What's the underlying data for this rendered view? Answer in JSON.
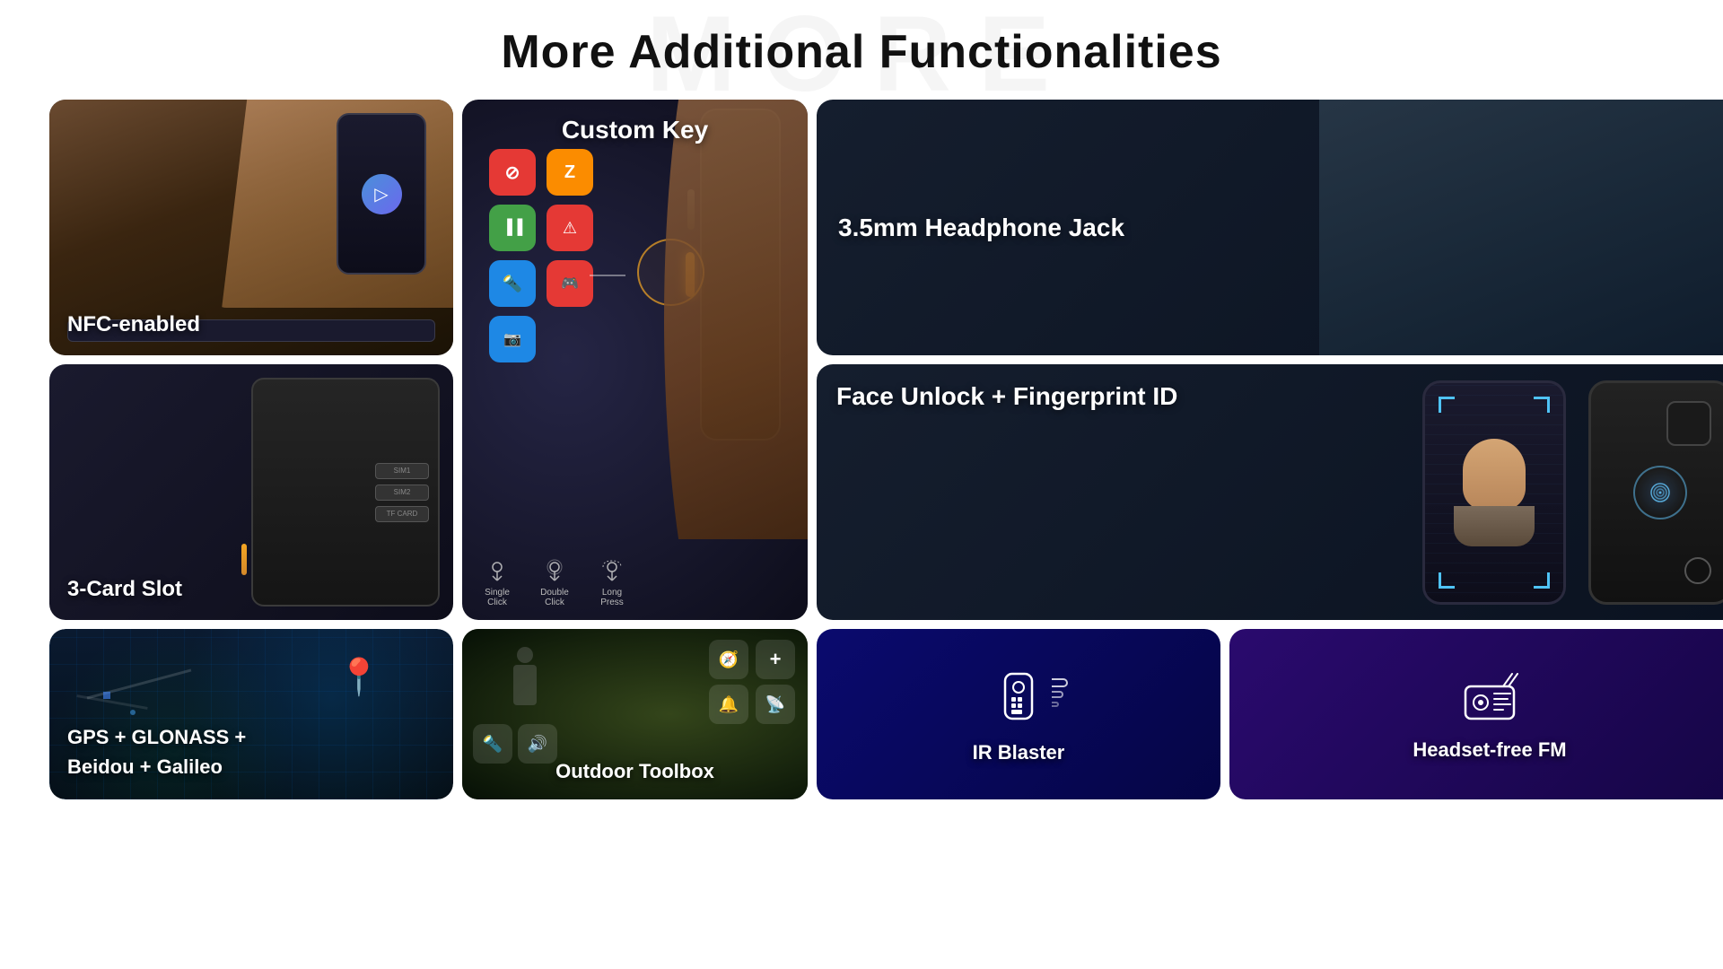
{
  "page": {
    "bg_text": "MORE",
    "title": "More Additional Functionalities"
  },
  "cards": {
    "nfc": {
      "label": "NFC-enabled"
    },
    "custom_key": {
      "title": "Custom Key",
      "clicks": [
        {
          "label": "Single Click"
        },
        {
          "label": "Double Click"
        },
        {
          "label": "Long Press"
        }
      ],
      "icons": [
        {
          "name": "no-icon",
          "symbol": "⊘",
          "color_class": "ck-icon-red"
        },
        {
          "name": "z-icon",
          "symbol": "Z",
          "color_class": "ck-icon-orange"
        },
        {
          "name": "chart-icon",
          "symbol": "📊",
          "color_class": "ck-icon-green"
        },
        {
          "name": "alert-icon",
          "symbol": "⚠",
          "color_class": "ck-icon-warn"
        },
        {
          "name": "torch-icon",
          "symbol": "🔦",
          "color_class": "ck-icon-blue-torch"
        },
        {
          "name": "game-icon",
          "symbol": "🎮",
          "color_class": "ck-icon-game"
        },
        {
          "name": "camera-icon",
          "symbol": "📷",
          "color_class": "ck-icon-cam"
        }
      ]
    },
    "headphone": {
      "label": "3.5mm Headphone Jack"
    },
    "face_unlock": {
      "label": "Face Unlock + Fingerprint ID"
    },
    "three_card": {
      "label": "3-Card Slot",
      "slots": [
        "SIM1",
        "SIM2",
        "TF CARD"
      ]
    },
    "gps": {
      "label": "GPS + GLONASS +\nBeidou + Galileo"
    },
    "outdoor": {
      "label": "Outdoor Toolbox"
    },
    "ir": {
      "label": "IR Blaster"
    },
    "fm": {
      "label": "Headset-free FM"
    }
  }
}
